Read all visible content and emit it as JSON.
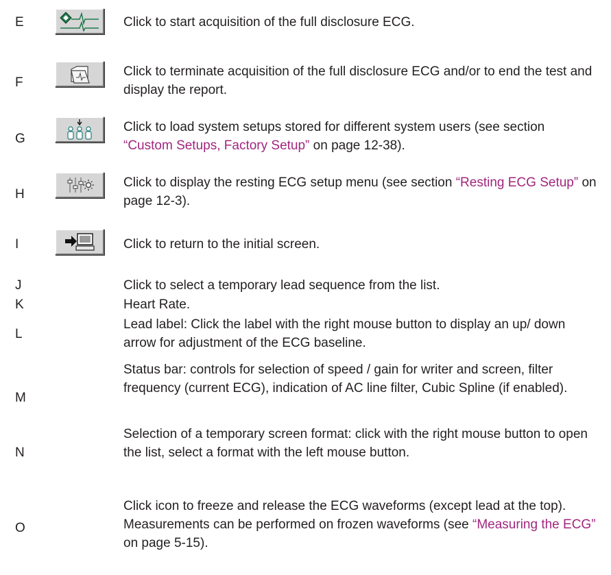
{
  "rows": [
    {
      "letter": "E",
      "text": "Click to start acquisition of the full disclosure ECG.",
      "icon": "start-ecg-acquisition-icon"
    },
    {
      "letter": "F",
      "text": "Click to terminate acquisition of the full disclosure ECG and/or to end the test and display the report.",
      "icon": "folder-ecg-icon"
    },
    {
      "letter": "G",
      "text_before": "Click to load system setups stored for different system users (see section ",
      "link": "“Custom Setups, Factory Setup”",
      "text_after": " on page 12-38).",
      "icon": "users-setup-icon"
    },
    {
      "letter": "H",
      "text_before": "Click to display the resting ECG setup menu (see section ",
      "link": "“Resting ECG Setup”",
      "text_after": " on page 12-3).",
      "icon": "setup-sliders-icon"
    },
    {
      "letter": "I",
      "text": "Click to return to the initial screen.",
      "icon": "return-initial-screen-icon"
    },
    {
      "letter": "J",
      "text": "Click to select a temporary lead sequence from the list."
    },
    {
      "letter": "K",
      "text": "Heart Rate."
    },
    {
      "letter": "L",
      "text": "Lead label: Click the label with the right mouse button to display an up/ down arrow for adjustment of the ECG baseline."
    },
    {
      "letter": "M",
      "text": "Status bar: controls for selection of speed / gain for writer and screen, filter frequency (current ECG), indication of AC line filter, Cubic Spline (if enabled)."
    },
    {
      "letter": "N",
      "text": "Selection of a temporary screen format: click with the right mouse button to open the list, select a format with the left mouse button."
    },
    {
      "letter": "O",
      "text_before": "Click icon to freeze and release the ECG waveforms (except lead at the top). Measurements can be performed on frozen waveforms (see ",
      "link": "“Measuring the ECG”",
      "text_after": " on page 5-15)."
    }
  ]
}
